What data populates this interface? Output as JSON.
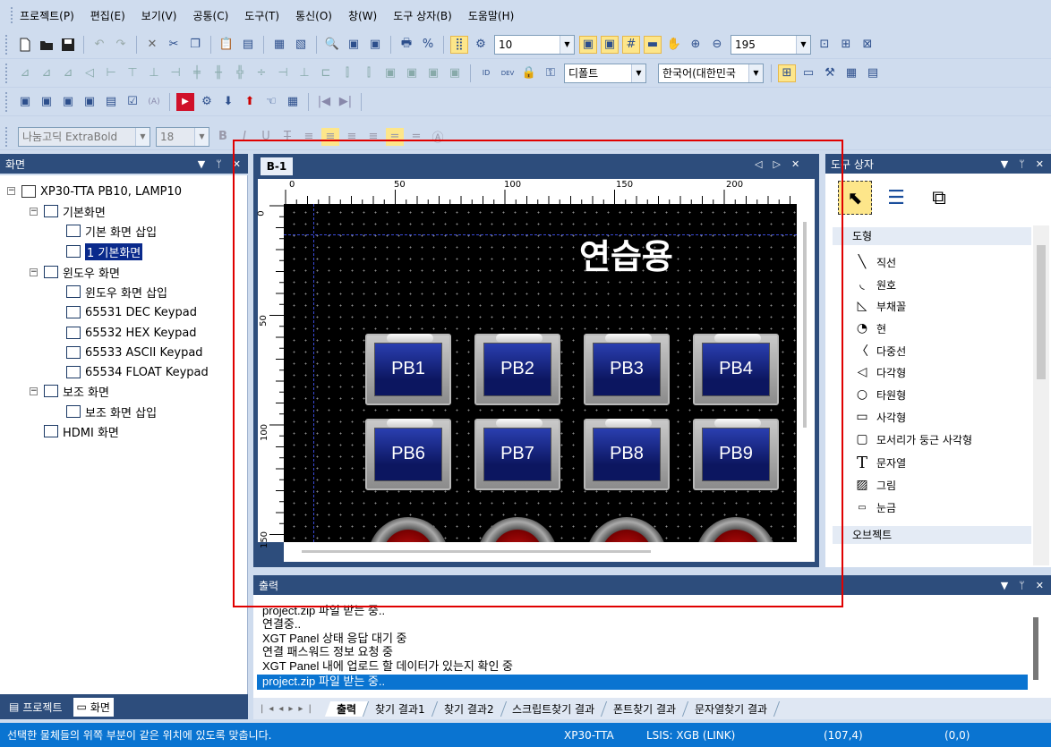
{
  "menu": [
    "프로젝트(P)",
    "편집(E)",
    "보기(V)",
    "공통(C)",
    "도구(T)",
    "통신(O)",
    "창(W)",
    "도구 상자(B)",
    "도움말(H)"
  ],
  "toolbar1": {
    "font_size_value": "10",
    "zoom_value": "195"
  },
  "toolbar2": {
    "style_value": "디폴트",
    "lang_value": "한국어(대한민국"
  },
  "toolbar4": {
    "font_name": "나눔고딕 ExtraBold",
    "font_px": "18"
  },
  "screen_panel": {
    "title": "화면",
    "root": "XP30-TTA PB10, LAMP10",
    "basic": "기본화면",
    "basic_insert": "기본 화면 삽입",
    "basic_1": "1 기본화면",
    "window": "윈도우 화면",
    "window_insert": "윈도우 화면 삽입",
    "k1": "65531 DEC Keypad",
    "k2": "65532 HEX Keypad",
    "k3": "65533 ASCII Keypad",
    "k4": "65534 FLOAT Keypad",
    "aux": "보조 화면",
    "aux_insert": "보조 화면 삽입",
    "hdmi": "HDMI 화면",
    "tab_project": "프로젝트",
    "tab_screen": "화면"
  },
  "editor": {
    "tab": "B-1",
    "title": "연습용",
    "buttons_row1": [
      "PB1",
      "PB2",
      "PB3",
      "PB4"
    ],
    "buttons_row2": [
      "PB6",
      "PB7",
      "PB8",
      "PB9"
    ],
    "ruler_h": [
      "0",
      "50",
      "100",
      "150",
      "200"
    ],
    "ruler_v": [
      "0",
      "50",
      "100",
      "150"
    ]
  },
  "toolbox": {
    "title": "도구 상자",
    "section_shapes": "도형",
    "items": [
      "직선",
      "원호",
      "부채꼴",
      "현",
      "다중선",
      "다각형",
      "타원형",
      "사각형",
      "모서리가 둥근 사각형",
      "문자열",
      "그림",
      "눈금"
    ],
    "section_objects": "오브젝트"
  },
  "output": {
    "title": "출력",
    "lines": [
      "project.zip 파일 받는 중..",
      "연결중..",
      "XGT Panel 상태 응답 대기 중",
      "연결 패스워드 정보 요청 중",
      "XGT Panel 내에 업로드 할 데이터가 있는지 확인 중",
      "project.zip 파일 받는 중.."
    ],
    "tabs": [
      "출력",
      "찾기 결과1",
      "찾기 결과2",
      "스크립트찾기 결과",
      "폰트찾기 결과",
      "문자열찾기 결과"
    ]
  },
  "status": {
    "message": "선택한 물체들의 위쪽 부분이 같은 위치에 있도록 맞춥니다.",
    "model": "XP30-TTA",
    "link": "LSIS: XGB (LINK)",
    "pos": "(107,4)",
    "size": "(0,0)"
  }
}
